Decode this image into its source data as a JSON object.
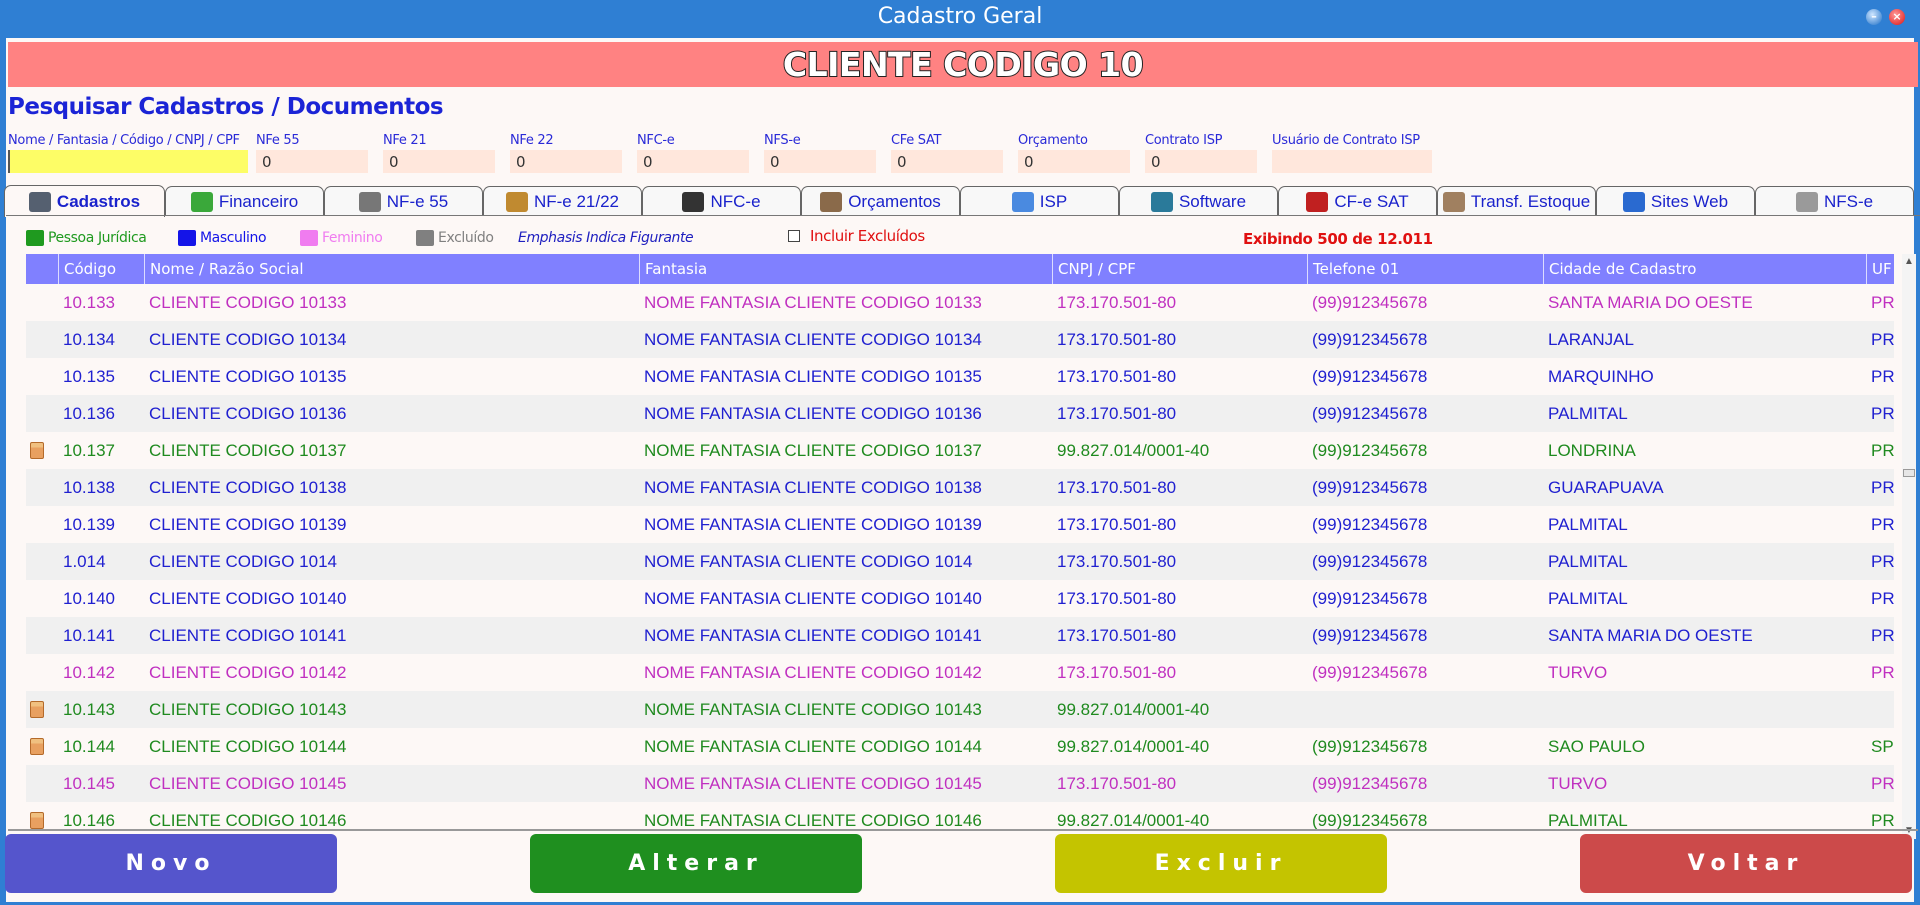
{
  "window": {
    "title": "Cadastro Geral"
  },
  "banner": {
    "text": "CLIENTE CODIGO 10"
  },
  "search": {
    "title": "Pesquisar Cadastros / Documentos",
    "fields": [
      {
        "label": "Nome / Fantasia / Código / CNPJ / CPF",
        "value": ""
      },
      {
        "label": "NFe 55",
        "value": "0"
      },
      {
        "label": "NFe 21",
        "value": "0"
      },
      {
        "label": "NFe 22",
        "value": "0"
      },
      {
        "label": "NFC-e",
        "value": "0"
      },
      {
        "label": "NFS-e",
        "value": "0"
      },
      {
        "label": "CFe SAT",
        "value": "0"
      },
      {
        "label": "Orçamento",
        "value": "0"
      },
      {
        "label": "Contrato ISP",
        "value": "0"
      },
      {
        "label": "Usuário de Contrato ISP",
        "value": ""
      }
    ]
  },
  "tabs": [
    {
      "label": "Cadastros",
      "icon": "people-icon",
      "active": true,
      "color": "#556070"
    },
    {
      "label": "Financeiro",
      "icon": "money-bag-icon",
      "active": false,
      "color": "#3aa83a"
    },
    {
      "label": "NF-e 55",
      "icon": "barcode-icon",
      "active": false,
      "color": "#777777"
    },
    {
      "label": "NF-e 21/22",
      "icon": "building-icon",
      "active": false,
      "color": "#c08a30"
    },
    {
      "label": "NFC-e",
      "icon": "printer-icon",
      "active": false,
      "color": "#333333"
    },
    {
      "label": "Orçamentos",
      "icon": "calculator-icon",
      "active": false,
      "color": "#8a6a4a"
    },
    {
      "label": "ISP",
      "icon": "document-pen-icon",
      "active": false,
      "color": "#4a8ae0"
    },
    {
      "label": "Software",
      "icon": "computer-icon",
      "active": false,
      "color": "#2a7a9a"
    },
    {
      "label": "CF-e SAT",
      "icon": "sat-icon",
      "active": false,
      "color": "#c02020"
    },
    {
      "label": "Transf. Estoque",
      "icon": "boxes-icon",
      "active": false,
      "color": "#a08060"
    },
    {
      "label": "Sites Web",
      "icon": "globe-icon",
      "active": false,
      "color": "#2a6ad0"
    },
    {
      "label": "NFS-e",
      "icon": "stack-icon",
      "active": false,
      "color": "#9a9a9a"
    }
  ],
  "legend": {
    "items": [
      {
        "label": "Pessoa Jurídica",
        "color": "#1f9a1f"
      },
      {
        "label": "Masculino",
        "color": "#1414e8"
      },
      {
        "label": "Feminino",
        "color": "#f07cf0"
      },
      {
        "label": "Excluído",
        "color": "#808080"
      }
    ],
    "emphasis_note": "Emphasis Indica Figurante",
    "include_excluded_label": "Incluir Excluídos",
    "count_text": "Exibindo 500 de 12.011"
  },
  "colors": {
    "pj": "#1f8a1f",
    "masc": "#2020d0",
    "fem": "#c030c0",
    "header": "#8080ff"
  },
  "table": {
    "columns": [
      "Código",
      "Nome / Razão Social",
      "Fantasia",
      "CNPJ / CPF",
      "Telefone 01",
      "Cidade de Cadastro",
      "UF"
    ],
    "rows": [
      {
        "type": "fem",
        "codigo": "10.133",
        "nome": "CLIENTE CODIGO 10133",
        "fantasia": "NOME FANTASIA CLIENTE CODIGO 10133",
        "doc": "173.170.501-80",
        "telefone": "(99)912345678",
        "cidade": "SANTA MARIA DO OESTE",
        "uf": "PR"
      },
      {
        "type": "masc",
        "codigo": "10.134",
        "nome": "CLIENTE CODIGO 10134",
        "fantasia": "NOME FANTASIA CLIENTE CODIGO 10134",
        "doc": "173.170.501-80",
        "telefone": "(99)912345678",
        "cidade": "LARANJAL",
        "uf": "PR"
      },
      {
        "type": "masc",
        "codigo": "10.135",
        "nome": "CLIENTE CODIGO 10135",
        "fantasia": "NOME FANTASIA CLIENTE CODIGO 10135",
        "doc": "173.170.501-80",
        "telefone": "(99)912345678",
        "cidade": "MARQUINHO",
        "uf": "PR"
      },
      {
        "type": "masc",
        "codigo": "10.136",
        "nome": "CLIENTE CODIGO 10136",
        "fantasia": "NOME FANTASIA CLIENTE CODIGO 10136",
        "doc": "173.170.501-80",
        "telefone": "(99)912345678",
        "cidade": "PALMITAL",
        "uf": "PR"
      },
      {
        "type": "pj",
        "codigo": "10.137",
        "nome": "CLIENTE CODIGO 10137",
        "fantasia": "NOME FANTASIA CLIENTE CODIGO 10137",
        "doc": "99.827.014/0001-40",
        "telefone": "(99)912345678",
        "cidade": "LONDRINA",
        "uf": "PR"
      },
      {
        "type": "masc",
        "codigo": "10.138",
        "nome": "CLIENTE CODIGO 10138",
        "fantasia": "NOME FANTASIA CLIENTE CODIGO 10138",
        "doc": "173.170.501-80",
        "telefone": "(99)912345678",
        "cidade": "GUARAPUAVA",
        "uf": "PR"
      },
      {
        "type": "masc",
        "codigo": "10.139",
        "nome": "CLIENTE CODIGO 10139",
        "fantasia": "NOME FANTASIA CLIENTE CODIGO 10139",
        "doc": "173.170.501-80",
        "telefone": "(99)912345678",
        "cidade": "PALMITAL",
        "uf": "PR"
      },
      {
        "type": "masc",
        "codigo": "1.014",
        "nome": "CLIENTE CODIGO 1014",
        "fantasia": "NOME FANTASIA CLIENTE CODIGO 1014",
        "doc": "173.170.501-80",
        "telefone": "(99)912345678",
        "cidade": "PALMITAL",
        "uf": "PR"
      },
      {
        "type": "masc",
        "codigo": "10.140",
        "nome": "CLIENTE CODIGO 10140",
        "fantasia": "NOME FANTASIA CLIENTE CODIGO 10140",
        "doc": "173.170.501-80",
        "telefone": "(99)912345678",
        "cidade": "PALMITAL",
        "uf": "PR"
      },
      {
        "type": "masc",
        "codigo": "10.141",
        "nome": "CLIENTE CODIGO 10141",
        "fantasia": "NOME FANTASIA CLIENTE CODIGO 10141",
        "doc": "173.170.501-80",
        "telefone": "(99)912345678",
        "cidade": "SANTA MARIA DO OESTE",
        "uf": "PR"
      },
      {
        "type": "fem",
        "codigo": "10.142",
        "nome": "CLIENTE CODIGO 10142",
        "fantasia": "NOME FANTASIA CLIENTE CODIGO 10142",
        "doc": "173.170.501-80",
        "telefone": "(99)912345678",
        "cidade": "TURVO",
        "uf": "PR"
      },
      {
        "type": "pj",
        "codigo": "10.143",
        "nome": "CLIENTE CODIGO 10143",
        "fantasia": "NOME FANTASIA CLIENTE CODIGO 10143",
        "doc": "99.827.014/0001-40",
        "telefone": "",
        "cidade": "",
        "uf": ""
      },
      {
        "type": "pj",
        "codigo": "10.144",
        "nome": "CLIENTE CODIGO 10144",
        "fantasia": "NOME FANTASIA CLIENTE CODIGO 10144",
        "doc": "99.827.014/0001-40",
        "telefone": "(99)912345678",
        "cidade": "SAO PAULO",
        "uf": "SP"
      },
      {
        "type": "fem",
        "codigo": "10.145",
        "nome": "CLIENTE CODIGO 10145",
        "fantasia": "NOME FANTASIA CLIENTE CODIGO 10145",
        "doc": "173.170.501-80",
        "telefone": "(99)912345678",
        "cidade": "TURVO",
        "uf": "PR"
      },
      {
        "type": "pj",
        "codigo": "10.146",
        "nome": "CLIENTE CODIGO 10146",
        "fantasia": "NOME FANTASIA CLIENTE CODIGO 10146",
        "doc": "99.827.014/0001-40",
        "telefone": "(99)912345678",
        "cidade": "PALMITAL",
        "uf": "PR"
      }
    ]
  },
  "buttons": [
    {
      "label": "Novo",
      "color": "#5555cc"
    },
    {
      "label": "Alterar",
      "color": "#1f8f1f"
    },
    {
      "label": "Excluir",
      "color": "#c4c400"
    },
    {
      "label": "Voltar",
      "color": "#cc4a4a"
    }
  ]
}
